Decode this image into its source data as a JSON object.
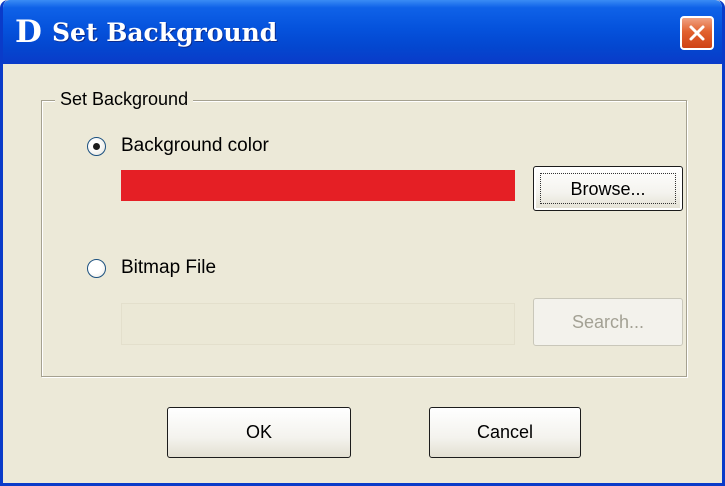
{
  "window": {
    "logo": "D",
    "title": "Set Background",
    "close_icon": "close-icon"
  },
  "group": {
    "legend": "Set Background"
  },
  "background_color": {
    "label": "Background color",
    "selected": true,
    "color": "#e51f25",
    "browse_label": "Browse..."
  },
  "bitmap_file": {
    "label": "Bitmap File",
    "selected": false,
    "value": "",
    "search_label": "Search...",
    "search_enabled": false
  },
  "buttons": {
    "ok_label": "OK",
    "cancel_label": "Cancel"
  },
  "colors": {
    "titlebar_accent": "#0552dc",
    "dialog_background": "#ece9d8",
    "close_button": "#e2622f"
  }
}
